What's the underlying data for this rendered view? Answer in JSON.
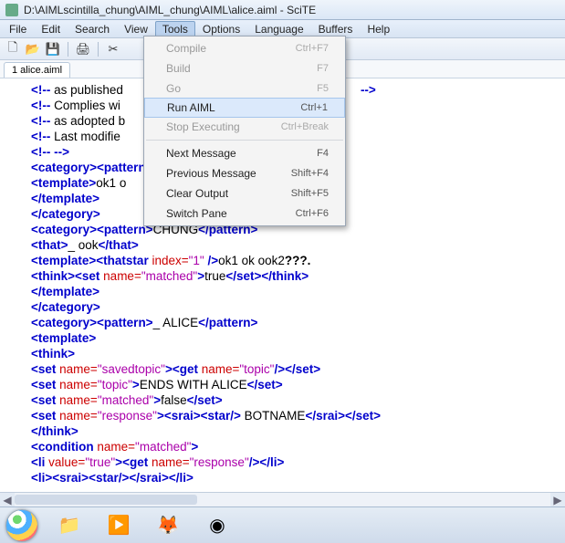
{
  "window": {
    "title": "D:\\AIMLscintilla_chung\\AIML_chung\\AIML\\alice.aiml - SciTE"
  },
  "menubar": {
    "items": [
      "File",
      "Edit",
      "Search",
      "View",
      "Tools",
      "Options",
      "Language",
      "Buffers",
      "Help"
    ],
    "active": "Tools"
  },
  "tabs": {
    "items": [
      "1 alice.aiml"
    ]
  },
  "dropdown": {
    "items": [
      {
        "label": "Compile",
        "shortcut": "Ctrl+F7",
        "disabled": true
      },
      {
        "label": "Build",
        "shortcut": "F7",
        "disabled": true
      },
      {
        "label": "Go",
        "shortcut": "F5",
        "disabled": true
      },
      {
        "label": "Run AIML",
        "shortcut": "Ctrl+1",
        "disabled": false,
        "hover": true
      },
      {
        "label": "Stop Executing",
        "shortcut": "Ctrl+Break",
        "disabled": true
      },
      "sep",
      {
        "label": "Next Message",
        "shortcut": "F4",
        "disabled": false
      },
      {
        "label": "Previous Message",
        "shortcut": "Shift+F4",
        "disabled": false
      },
      {
        "label": "Clear Output",
        "shortcut": "Shift+F5",
        "disabled": false
      },
      {
        "label": "Switch Pane",
        "shortcut": "Ctrl+F6",
        "disabled": false
      }
    ]
  },
  "code": {
    "l1a": "<!--",
    "l1b": " as published",
    "l1c": "-->",
    "l2a": "<!--",
    "l2b": " Complies wi",
    "l3a": "<!--",
    "l3b": " as adopted b",
    "l4a": "<!--",
    "l4b": " Last modifie",
    "l5a": "<!--",
    "l5b": " -->",
    "l6a": "<category>",
    "l6b": "<pattern>",
    "l7a": "<template>",
    "l7b": "ok1 o",
    "l8a": "</template>",
    "l9a": "</category>",
    "l10a": "<category>",
    "l10b": "<pattern>",
    "l10c": "CHUNG",
    "l10d": "</pattern>",
    "l11a": "<that>",
    "l11b": "_ ook",
    "l11c": "</that>",
    "l12a": "<template>",
    "l12b": "<thatstar",
    "l12c": "   index=",
    "l12d": "\"1\"",
    "l12e": " />",
    "l12f": "ok1 ok ook2",
    "l12g": "???.",
    "l13a": "<think>",
    "l13b": "<set",
    "l13c": " name=",
    "l13d": "\"matched\"",
    "l13e": ">",
    "l13f": "true",
    "l13g": "</set>",
    "l13h": "</think>",
    "l14a": "</template>",
    "l15a": "</category>",
    "l16a": "<category>",
    "l16b": "<pattern>",
    "l16c": "_ ALICE",
    "l16d": "</pattern>",
    "l17a": "<template>",
    "l18a": "<think>",
    "l19a": "<set",
    "l19b": " name=",
    "l19c": "\"savedtopic\"",
    "l19d": ">",
    "l19e": "<get",
    "l19f": " name=",
    "l19g": "\"topic\"",
    "l19h": "/>",
    "l19i": "</set>",
    "l20a": "<set",
    "l20b": " name=",
    "l20c": "\"topic\"",
    "l20d": ">",
    "l20e": "ENDS WITH ALICE",
    "l20f": "</set>",
    "l21a": "<set",
    "l21b": " name=",
    "l21c": "\"matched\"",
    "l21d": ">",
    "l21e": "false",
    "l21f": "</set>",
    "l22a": "<set",
    "l22b": " name=",
    "l22c": "\"response\"",
    "l22d": ">",
    "l22e": "<srai>",
    "l22f": "<star/>",
    "l22g": " BOTNAME",
    "l22h": "</srai>",
    "l22i": "</set>",
    "l23a": "</think>",
    "l24a": "<condition",
    "l24b": " name=",
    "l24c": "\"matched\"",
    "l24d": ">",
    "l25a": "<li",
    "l25b": " value=",
    "l25c": "\"true\"",
    "l25d": ">",
    "l25e": "<get",
    "l25f": " name=",
    "l25g": "\"response\"",
    "l25h": "/>",
    "l25i": "</li>",
    "l26a": "<li>",
    "l26b": "<srai>",
    "l26c": "<star/>",
    "l26d": "</srai>",
    "l26e": "</li>"
  },
  "task_icons": [
    "folder-icon",
    "media-icon",
    "firefox-icon",
    "app-icon"
  ]
}
